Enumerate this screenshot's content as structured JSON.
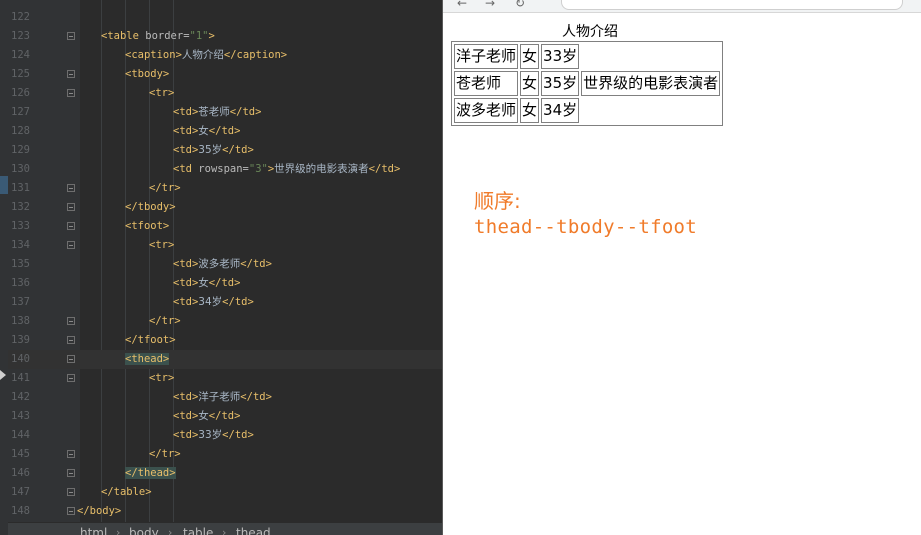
{
  "editor": {
    "lines": [
      {
        "n": "122",
        "fold": false,
        "indent": 0,
        "parts": []
      },
      {
        "n": "123",
        "fold": true,
        "indent": 0,
        "parts": [
          [
            "tg",
            "<table "
          ],
          [
            "at",
            "border="
          ],
          [
            "vl",
            "\"1\""
          ],
          [
            "tg",
            ">"
          ]
        ]
      },
      {
        "n": "124",
        "fold": false,
        "indent": 1,
        "parts": [
          [
            "tg",
            "<caption>"
          ],
          [
            "tx",
            "人物介绍"
          ],
          [
            "tg",
            "</caption>"
          ]
        ]
      },
      {
        "n": "125",
        "fold": true,
        "indent": 1,
        "parts": [
          [
            "tg",
            "<tbody>"
          ]
        ]
      },
      {
        "n": "126",
        "fold": true,
        "indent": 2,
        "parts": [
          [
            "tg",
            "<tr>"
          ]
        ]
      },
      {
        "n": "127",
        "fold": false,
        "indent": 3,
        "parts": [
          [
            "tg",
            "<td>"
          ],
          [
            "tx",
            "苍老师"
          ],
          [
            "tg",
            "</td>"
          ]
        ]
      },
      {
        "n": "128",
        "fold": false,
        "indent": 3,
        "parts": [
          [
            "tg",
            "<td>"
          ],
          [
            "tx",
            "女"
          ],
          [
            "tg",
            "</td>"
          ]
        ]
      },
      {
        "n": "129",
        "fold": false,
        "indent": 3,
        "parts": [
          [
            "tg",
            "<td>"
          ],
          [
            "tx",
            "35岁"
          ],
          [
            "tg",
            "</td>"
          ]
        ]
      },
      {
        "n": "130",
        "fold": false,
        "indent": 3,
        "parts": [
          [
            "tg",
            "<td "
          ],
          [
            "at",
            "rowspan="
          ],
          [
            "vl",
            "\"3\""
          ],
          [
            "tg",
            ">"
          ],
          [
            "tx",
            "世界级的电影表演者"
          ],
          [
            "tg",
            "</td>"
          ]
        ]
      },
      {
        "n": "131",
        "fold": true,
        "indent": 2,
        "parts": [
          [
            "tg",
            "</tr>"
          ]
        ]
      },
      {
        "n": "132",
        "fold": true,
        "indent": 1,
        "parts": [
          [
            "tg",
            "</tbody>"
          ]
        ]
      },
      {
        "n": "133",
        "fold": true,
        "indent": 1,
        "parts": [
          [
            "tg",
            "<tfoot>"
          ]
        ]
      },
      {
        "n": "134",
        "fold": true,
        "indent": 2,
        "parts": [
          [
            "tg",
            "<tr>"
          ]
        ]
      },
      {
        "n": "135",
        "fold": false,
        "indent": 3,
        "parts": [
          [
            "tg",
            "<td>"
          ],
          [
            "tx",
            "波多老师"
          ],
          [
            "tg",
            "</td>"
          ]
        ]
      },
      {
        "n": "136",
        "fold": false,
        "indent": 3,
        "parts": [
          [
            "tg",
            "<td>"
          ],
          [
            "tx",
            "女"
          ],
          [
            "tg",
            "</td>"
          ]
        ]
      },
      {
        "n": "137",
        "fold": false,
        "indent": 3,
        "parts": [
          [
            "tg",
            "<td>"
          ],
          [
            "tx",
            "34岁"
          ],
          [
            "tg",
            "</td>"
          ]
        ]
      },
      {
        "n": "138",
        "fold": true,
        "indent": 2,
        "parts": [
          [
            "tg",
            "</tr>"
          ]
        ]
      },
      {
        "n": "139",
        "fold": true,
        "indent": 1,
        "parts": [
          [
            "tg",
            "</tfoot>"
          ]
        ]
      },
      {
        "n": "140",
        "fold": true,
        "indent": 1,
        "current": true,
        "parts": [
          [
            "tg hl",
            "<thead>"
          ]
        ]
      },
      {
        "n": "141",
        "fold": true,
        "indent": 2,
        "parts": [
          [
            "tg",
            "<tr>"
          ]
        ]
      },
      {
        "n": "142",
        "fold": false,
        "indent": 3,
        "parts": [
          [
            "tg",
            "<td>"
          ],
          [
            "tx",
            "洋子老师"
          ],
          [
            "tg",
            "</td>"
          ]
        ]
      },
      {
        "n": "143",
        "fold": false,
        "indent": 3,
        "parts": [
          [
            "tg",
            "<td>"
          ],
          [
            "tx",
            "女"
          ],
          [
            "tg",
            "</td>"
          ]
        ]
      },
      {
        "n": "144",
        "fold": false,
        "indent": 3,
        "parts": [
          [
            "tg",
            "<td>"
          ],
          [
            "tx",
            "33岁"
          ],
          [
            "tg",
            "</td>"
          ]
        ]
      },
      {
        "n": "145",
        "fold": true,
        "indent": 2,
        "parts": [
          [
            "tg",
            "</tr>"
          ]
        ]
      },
      {
        "n": "146",
        "fold": true,
        "indent": 1,
        "parts": [
          [
            "tg hl",
            "</thead>"
          ]
        ]
      },
      {
        "n": "147",
        "fold": true,
        "indent": 0,
        "parts": [
          [
            "tg",
            "</table>"
          ]
        ]
      },
      {
        "n": "148",
        "fold": true,
        "indent": -1,
        "parts": [
          [
            "tg",
            "</body>"
          ]
        ]
      }
    ],
    "breadcrumb": [
      "html",
      "body",
      "table",
      "thead"
    ]
  },
  "browser": {
    "caption": "人物介绍",
    "rows": [
      [
        "洋子老师",
        "女",
        "33岁"
      ],
      [
        "苍老师",
        "女",
        "35岁",
        "世界级的电影表演者"
      ],
      [
        "波多老师",
        "女",
        "34岁"
      ]
    ],
    "note_title": "顺序:",
    "note_body": "thead--tbody--tfoot"
  },
  "colors": {
    "editor_bg": "#2b2b2b",
    "tag": "#e8bf6a",
    "attr_value": "#6a8759",
    "note": "#f07b2a"
  }
}
